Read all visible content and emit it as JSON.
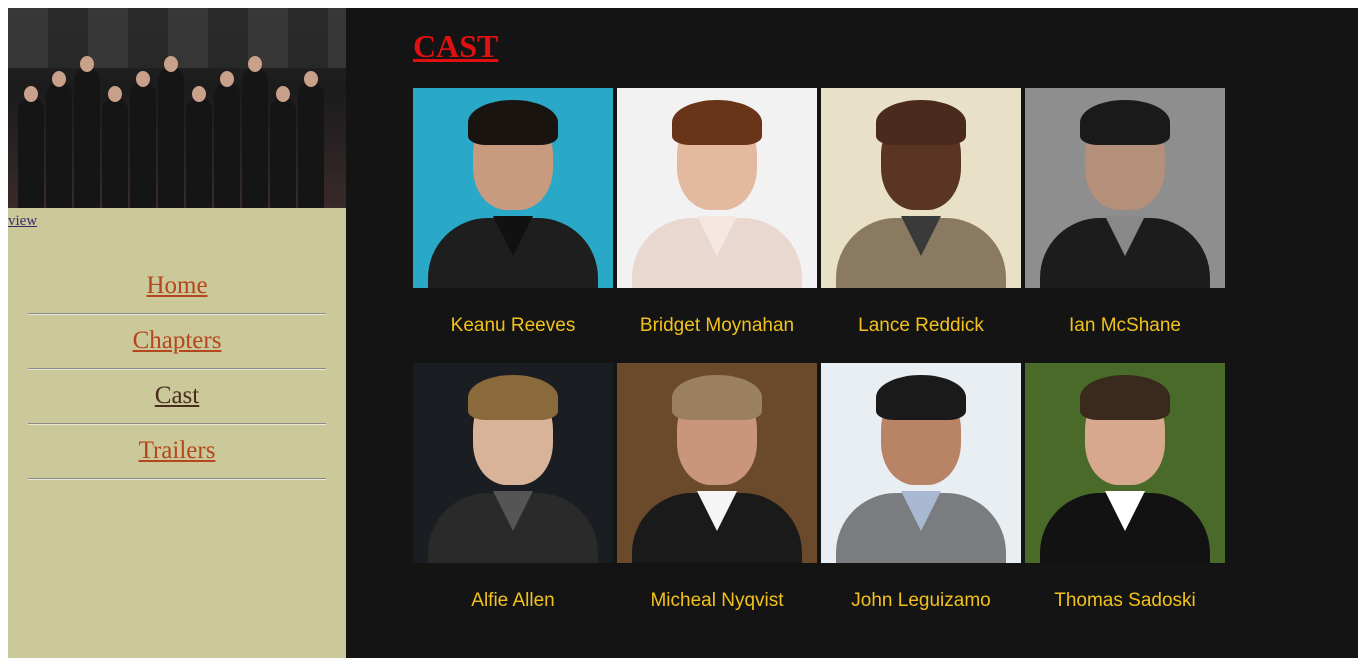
{
  "sidebar": {
    "banner_alt": "cast group photo",
    "view_link": "view",
    "nav": [
      {
        "label": "Home",
        "active": false
      },
      {
        "label": "Chapters",
        "active": false
      },
      {
        "label": "Cast",
        "active": true
      },
      {
        "label": "Trailers",
        "active": false
      }
    ]
  },
  "main": {
    "heading": "CAST",
    "cast": [
      {
        "name": "Keanu Reeves",
        "bg": "#2aa8c8",
        "skin": "#c89a7e",
        "hair": "#1a1410",
        "body": "#1e1e1e",
        "collar": "#111111"
      },
      {
        "name": "Bridget Moynahan",
        "bg": "#f2f2f2",
        "skin": "#e3b9a0",
        "hair": "#6a3418",
        "body": "#e9d8d0",
        "collar": "#f4e7e2"
      },
      {
        "name": "Lance Reddick",
        "bg": "#e9e0c8",
        "skin": "#5b3524",
        "hair": "#4a2a1c",
        "body": "#8a7a62",
        "collar": "#3a3a3a"
      },
      {
        "name": "Ian McShane",
        "bg": "#8e8e8e",
        "skin": "#b48f7a",
        "hair": "#1a1a1a",
        "body": "#1c1c1c",
        "collar": "#888888"
      },
      {
        "name": "Alfie Allen",
        "bg": "#1a1e22",
        "skin": "#d9b29a",
        "hair": "#8a6a3a",
        "body": "#2a2a2a",
        "collar": "#555555"
      },
      {
        "name": "Micheal Nyqvist",
        "bg": "#6a4a2a",
        "skin": "#c9967c",
        "hair": "#9a8060",
        "body": "#1a1a1a",
        "collar": "#f5f5f5"
      },
      {
        "name": "John Leguizamo",
        "bg": "#e8eef2",
        "skin": "#b98466",
        "hair": "#1a1a1a",
        "body": "#7a7c80",
        "collar": "#a8b8d0"
      },
      {
        "name": "Thomas Sadoski",
        "bg": "#4a6a2a",
        "skin": "#d7a88e",
        "hair": "#3a2a1e",
        "body": "#121212",
        "collar": "#ffffff"
      }
    ]
  },
  "colors": {
    "sidebar_bg": "#cbc999",
    "main_bg": "#141414",
    "heading": "#e01010",
    "cast_name": "#f2c21b",
    "nav_link": "#b5461d",
    "nav_active": "#4a2b1e"
  }
}
